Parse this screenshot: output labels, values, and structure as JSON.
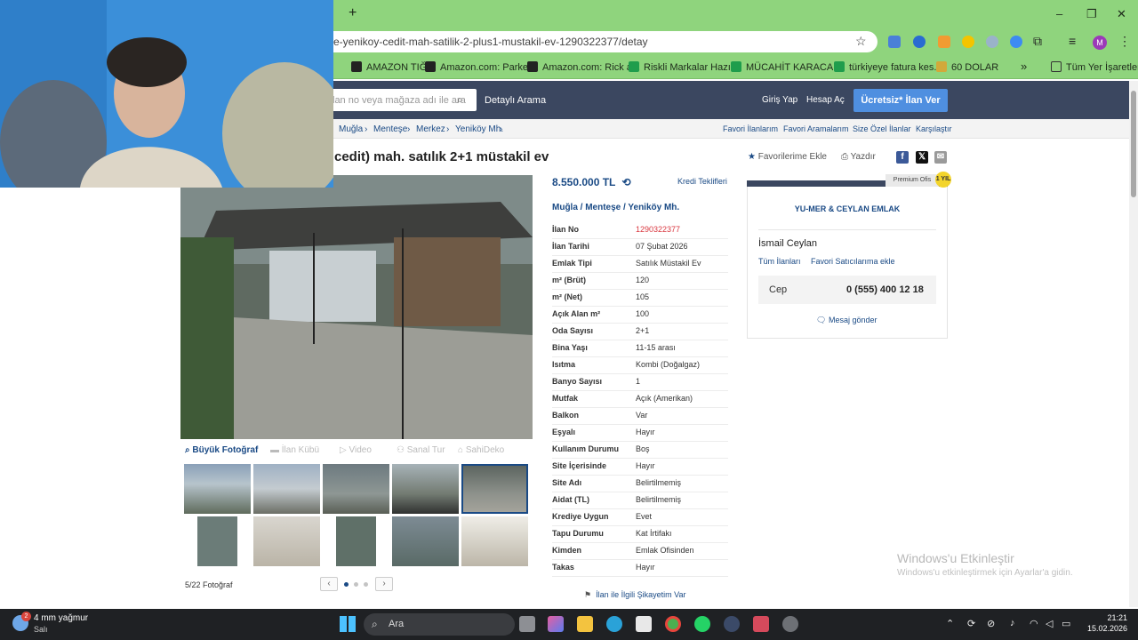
{
  "browser": {
    "new_tab": "+",
    "url": "e-yenikoy-cedit-mah-satilik-2-plus1-mustakil-ev-1290322377/detay",
    "bookmarks": [
      "AMAZON TIĞ",
      "Amazon.com: Parke...",
      "Amazon.com: Rick a...",
      "Riskli Markalar Hazır...",
      "MÜCAHİT KARACA...",
      "türkiyeye fatura kes...",
      "60 DOLAR"
    ],
    "bookmarks_more": "»",
    "all_bookmarks": "Tüm Yer İşaretleri",
    "profile_initial": "M",
    "window_controls": {
      "minimize": "–",
      "maximize": "❐",
      "close": "✕"
    }
  },
  "site": {
    "search_placeholder": "lan no veya mağaza adı ile ara",
    "detailed_search": "Detaylı Arama",
    "login": "Giriş Yap",
    "register": "Hesap Aç",
    "post_ad": "Ücretsiz* İlan Ver"
  },
  "breadcrumb": [
    "Muğla",
    "Menteşe",
    "Merkez",
    "Yeniköy Mh."
  ],
  "breadcrumb_sep": "›",
  "subnav_links": [
    "Favori İlanlarım",
    "Favori Aramalarım",
    "Size Özel İlanlar",
    "Karşılaştır"
  ],
  "listing": {
    "title": "cedit) mah. satılık 2+1 müstakil ev",
    "favorite": "Favorilerime Ekle",
    "print": "Yazdır",
    "price": "8.550.000 TL",
    "credit": "Kredi Teklifleri",
    "location": "Muğla  /  Menteşe  /  Yeniköy Mh.",
    "details": [
      {
        "k": "İlan No",
        "v": "1290322377",
        "red": true
      },
      {
        "k": "İlan Tarihi",
        "v": "07 Şubat 2026"
      },
      {
        "k": "Emlak Tipi",
        "v": "Satılık Müstakil Ev"
      },
      {
        "k": "m² (Brüt)",
        "v": "120"
      },
      {
        "k": "m² (Net)",
        "v": "105"
      },
      {
        "k": "Açık Alan m²",
        "v": "100"
      },
      {
        "k": "Oda Sayısı",
        "v": "2+1"
      },
      {
        "k": "Bina Yaşı",
        "v": "11-15 arası"
      },
      {
        "k": "Isıtma",
        "v": "Kombi (Doğalgaz)"
      },
      {
        "k": "Banyo Sayısı",
        "v": "1"
      },
      {
        "k": "Mutfak",
        "v": "Açık (Amerikan)"
      },
      {
        "k": "Balkon",
        "v": "Var"
      },
      {
        "k": "Eşyalı",
        "v": "Hayır"
      },
      {
        "k": "Kullanım Durumu",
        "v": "Boş"
      },
      {
        "k": "Site İçerisinde",
        "v": "Hayır"
      },
      {
        "k": "Site Adı",
        "v": "Belirtilmemiş"
      },
      {
        "k": "Aidat (TL)",
        "v": "Belirtilmemiş"
      },
      {
        "k": "Krediye Uygun",
        "v": "Evet"
      },
      {
        "k": "Tapu Durumu",
        "v": "Kat İrtifakı"
      },
      {
        "k": "Kimden",
        "v": "Emlak Ofisinden"
      },
      {
        "k": "Takas",
        "v": "Hayır"
      }
    ],
    "complaint": "İlan ile İlgili Şikayetim Var"
  },
  "photos": {
    "tabs": [
      "Büyük Fotoğraf",
      "İlan Kübü",
      "Video",
      "Sanal Tur",
      "SahiDeko"
    ],
    "count": "5/22 Fotoğraf",
    "prev": "‹",
    "next": "›"
  },
  "agent": {
    "premium": "Premium Ofis",
    "badge": "1 YIL",
    "agency": "YU-MER & CEYLAN EMLAK",
    "name": "İsmail Ceylan",
    "all_listings": "Tüm İlanları",
    "add_favorite": "Favori Satıcılarıma ekle",
    "phone_label": "Cep",
    "phone": "0 (555) 400 12 18",
    "message": "Mesaj gönder"
  },
  "windows": {
    "activate_title": "Windows'u Etkinleştir",
    "activate_sub": "Windows'u etkinleştirmek için Ayarlar'a gidin.",
    "weather_temp": "4 mm yağmur",
    "weather_day": "Salı",
    "weather_badge": "2",
    "search": "Ara",
    "time": "21:21",
    "date": "15.02.2026"
  }
}
